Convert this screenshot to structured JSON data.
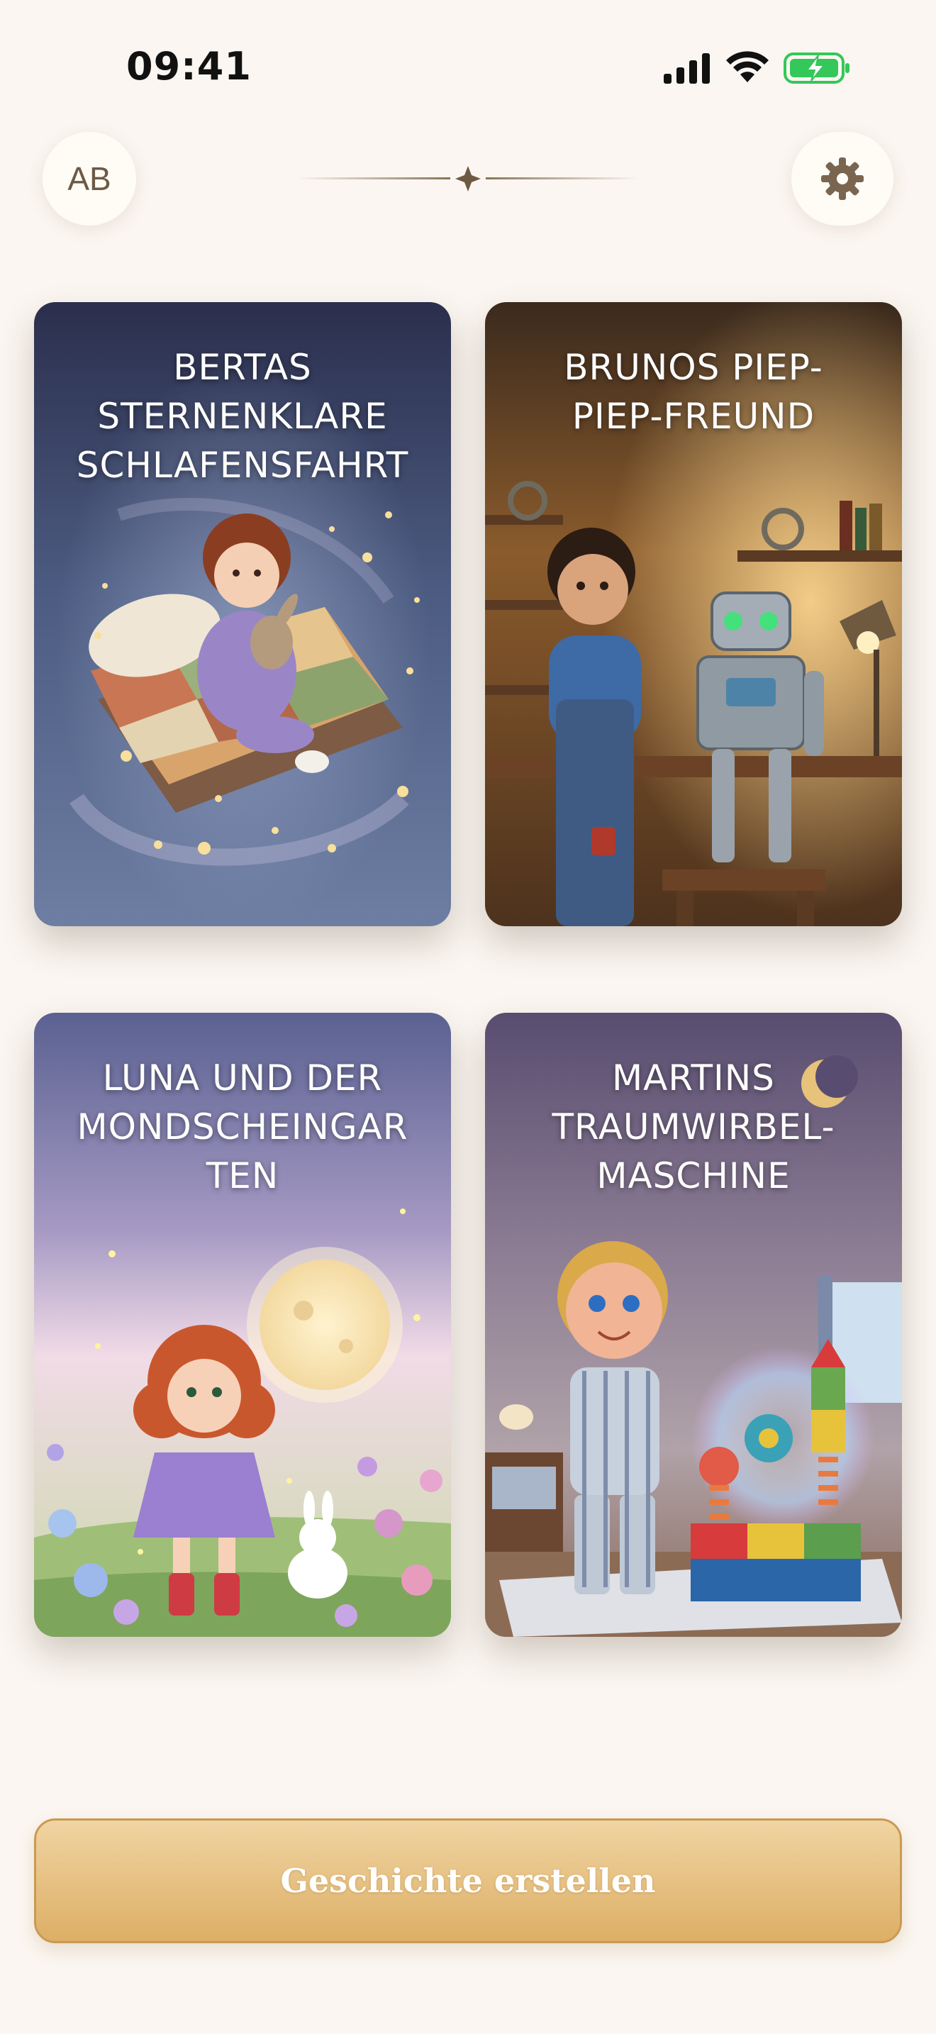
{
  "status_bar": {
    "time": "09:41",
    "icons": [
      "cellular-signal-icon",
      "wifi-icon",
      "battery-charging-icon"
    ],
    "battery_color": "#34c759"
  },
  "header": {
    "avatar_initials": "AB",
    "settings_icon": "gear-icon"
  },
  "stories": [
    {
      "title": "BERTAS\nSTERNENKLARE\nSCHLAFENSFAHRT"
    },
    {
      "title": "BRUNOS PIEP-\nPIEP-FREUND"
    },
    {
      "title": "LUNA UND DER\nMONDSCHEINGAR\nTEN"
    },
    {
      "title": "MARTINS\nTRAUMWIRBEL-\nMASCHINE"
    }
  ],
  "cta": {
    "label": "Geschichte erstellen"
  },
  "colors": {
    "background": "#fbf6f1",
    "accent": "#ddaf66",
    "header_icon": "#7a6650"
  }
}
